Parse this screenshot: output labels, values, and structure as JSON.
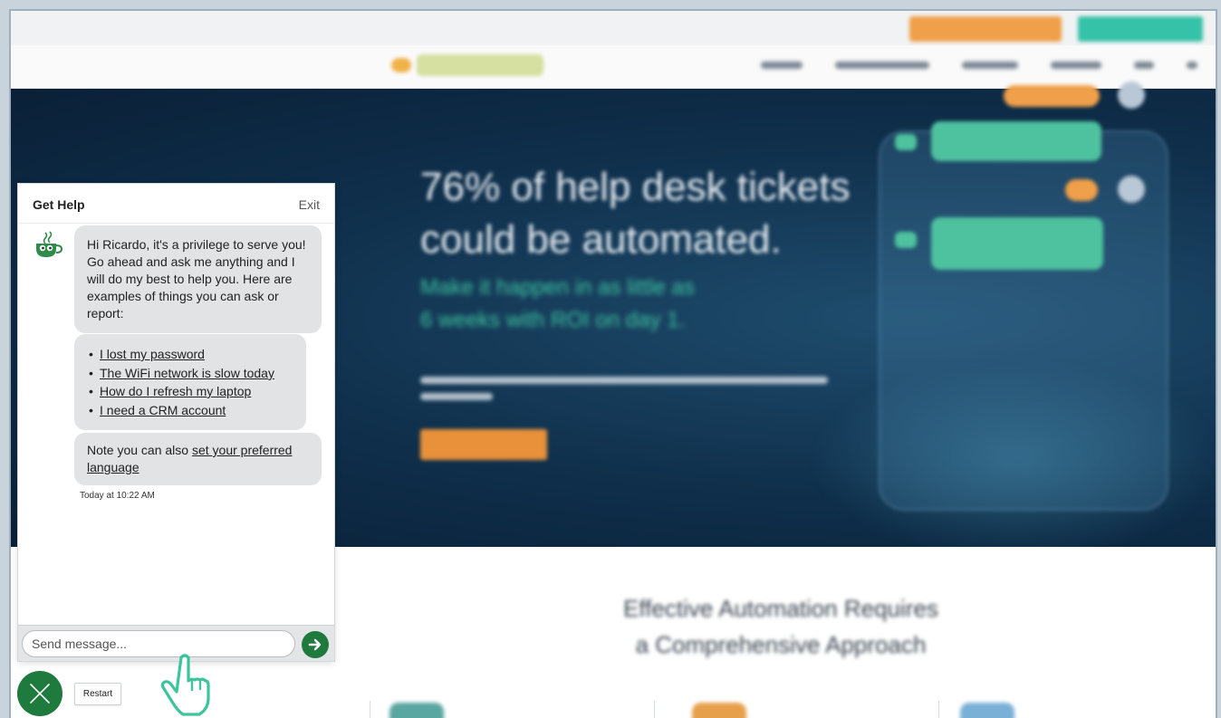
{
  "hero": {
    "title": "76% of help desk tickets\ncould be automated.",
    "subtitle": "Make it happen in as little as\n6 weeks with ROI on day 1."
  },
  "section": {
    "title": "Effective Automation Requires\na Comprehensive Approach"
  },
  "chat": {
    "title": "Get Help",
    "exit_label": "Exit",
    "greeting": "Hi Ricardo, it's a privilege to serve you! Go ahead and ask me anything and I will do my best to help you. Here are examples of things you can ask or report:",
    "examples": [
      "I lost my password",
      "The WiFi network is slow today",
      "How do I refresh my laptop",
      "I need a CRM account"
    ],
    "note_prefix": "Note you can also ",
    "note_link": "set your preferred language",
    "timestamp": "Today at 10:22 AM",
    "input_placeholder": "Send message...",
    "input_value": ""
  },
  "controls": {
    "restart_label": "Restart"
  },
  "colors": {
    "brand_green": "#1f7a3d",
    "bubble_bg": "#e1e3e5",
    "hero_bg": "#0f2f4b",
    "accent_orange": "#e8913a",
    "accent_teal": "#3fc6a2"
  },
  "icons": {
    "bot": "coffee-cup-icon",
    "send": "send-arrow-icon",
    "close": "close-x-icon",
    "cursor": "pointing-hand-icon"
  }
}
